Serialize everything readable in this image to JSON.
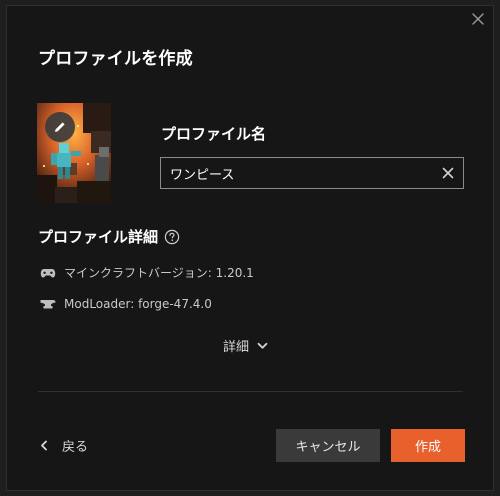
{
  "dialog": {
    "title": "プロファイルを作成",
    "close_icon": "close-icon"
  },
  "profile": {
    "name_label": "プロファイル名",
    "name_value": "ワンピース",
    "avatar_edit_icon": "pencil-icon",
    "clear_icon": "close-icon"
  },
  "details": {
    "heading": "プロファイル詳細",
    "help_icon": "question-circle-icon",
    "game_version": {
      "icon": "gamepad-icon",
      "text": "マインクラフトバージョン: 1.20.1"
    },
    "mod_loader": {
      "icon": "anvil-icon",
      "text": "ModLoader: forge-47.4.0"
    },
    "more_label": "詳細",
    "more_icon": "chevron-down-icon"
  },
  "footer": {
    "back_label": "戻る",
    "back_icon": "chevron-left-icon",
    "cancel_label": "キャンセル",
    "create_label": "作成"
  },
  "colors": {
    "background": "#161616",
    "accent": "#e8612c",
    "secondary_button": "#3a3a3a"
  }
}
